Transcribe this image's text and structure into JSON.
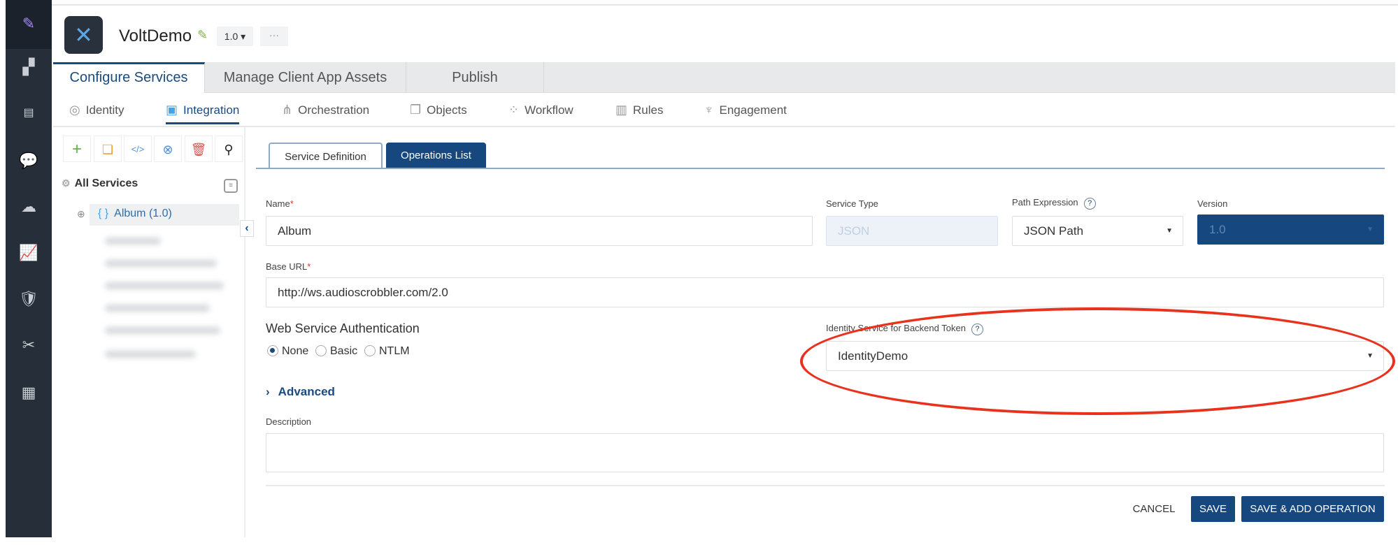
{
  "app": {
    "title": "VoltDemo",
    "version": "1.0",
    "more": "···"
  },
  "main_tabs": [
    {
      "label": "Configure Services",
      "active": true
    },
    {
      "label": "Manage Client App Assets"
    },
    {
      "label": "Publish"
    }
  ],
  "sub_nav": [
    {
      "label": "Identity",
      "icon": "fingerprint-icon"
    },
    {
      "label": "Integration",
      "icon": "puzzle-icon",
      "active": true
    },
    {
      "label": "Orchestration",
      "icon": "orchestration-icon"
    },
    {
      "label": "Objects",
      "icon": "objects-icon"
    },
    {
      "label": "Workflow",
      "icon": "workflow-icon"
    },
    {
      "label": "Rules",
      "icon": "rules-book-icon"
    },
    {
      "label": "Engagement",
      "icon": "antenna-icon"
    }
  ],
  "left_panel": {
    "all_services": "All Services",
    "selected_service": "Album (1.0)"
  },
  "form": {
    "tabs": {
      "definition": "Service Definition",
      "operations": "Operations List"
    },
    "name_label": "Name",
    "name_value": "Album",
    "service_type_label": "Service Type",
    "service_type_value": "JSON",
    "path_label": "Path Expression",
    "path_value": "JSON Path",
    "version_label": "Version",
    "version_value": "1.0",
    "base_url_label": "Base URL",
    "base_url_value": "http://ws.audioscrobbler.com/2.0",
    "auth_label": "Web Service Authentication",
    "auth_options": [
      "None",
      "Basic",
      "NTLM"
    ],
    "identity_label": "Identity Service for Backend Token",
    "identity_value": "IdentityDemo",
    "advanced": "Advanced",
    "description_label": "Description",
    "required_mark": "*",
    "help": "?"
  },
  "buttons": {
    "cancel": "CANCEL",
    "save": "SAVE",
    "save_add": "SAVE & ADD OPERATION"
  },
  "colors": {
    "accent": "#1a4b80",
    "button": "#17477f",
    "rail": "#252e39",
    "annotation": "#e8321e"
  }
}
